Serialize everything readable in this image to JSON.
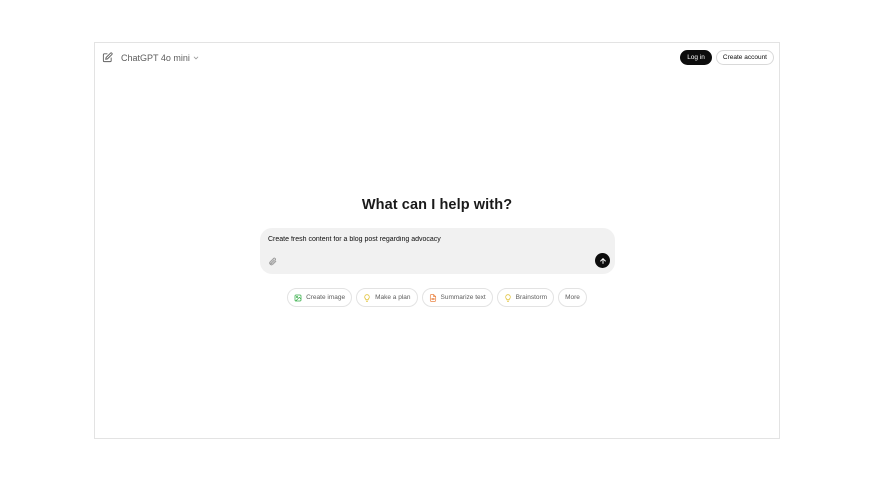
{
  "header": {
    "model_label": "ChatGPT 4o mini",
    "login_label": "Log in",
    "create_account_label": "Create account"
  },
  "main": {
    "title": "What can I help with?",
    "composer": {
      "value": "Create fresh content for a blog post regarding advocacy"
    },
    "chips": [
      {
        "label": "Create image",
        "icon": "image-icon",
        "color": "#35ae47"
      },
      {
        "label": "Make a plan",
        "icon": "lightbulb-icon",
        "color": "#e2c541"
      },
      {
        "label": "Summarize text",
        "icon": "document-icon",
        "color": "#ea8444"
      },
      {
        "label": "Brainstorm",
        "icon": "lightbulb-icon",
        "color": "#e2c541"
      },
      {
        "label": "More",
        "icon": "",
        "color": ""
      }
    ]
  }
}
